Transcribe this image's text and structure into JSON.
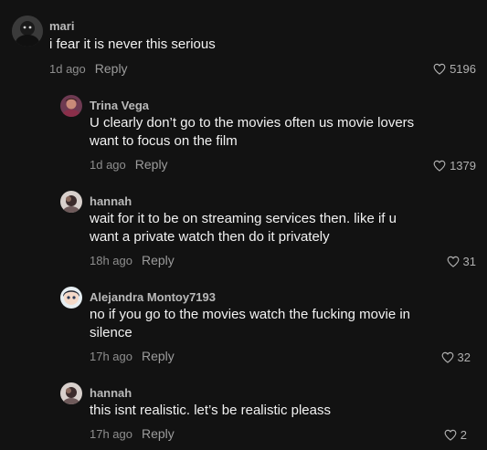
{
  "colors": {
    "background": "#121212",
    "username": "#b9b9b9",
    "text": "#f2f2f2",
    "meta": "#8e8e8e"
  },
  "comments": [
    {
      "username": "mari",
      "text": "i fear it is never this serious",
      "time": "1d ago",
      "reply_label": "Reply",
      "likes": "5196",
      "like_icon": "heart-outline-icon"
    },
    {
      "username": "Trina Vega",
      "text": "U clearly don’t go to the movies often us movie lovers want to focus on the film",
      "time": "1d ago",
      "reply_label": "Reply",
      "likes": "1379",
      "like_icon": "heart-outline-icon"
    },
    {
      "username": "hannah",
      "text": "wait for it to be on streaming services then. like if u want a private watch then do it privately",
      "time": "18h ago",
      "reply_label": "Reply",
      "likes": "31",
      "like_icon": "heart-outline-icon"
    },
    {
      "username": "Alejandra Montoy7193",
      "text": "no if you go to the movies watch the fucking movie in silence",
      "time": "17h ago",
      "reply_label": "Reply",
      "likes": "32",
      "like_icon": "heart-outline-icon"
    },
    {
      "username": "hannah",
      "text": "this isnt realistic. let’s be realistic pleass",
      "time": "17h ago",
      "reply_label": "Reply",
      "likes": "2",
      "like_icon": "heart-outline-icon"
    }
  ]
}
